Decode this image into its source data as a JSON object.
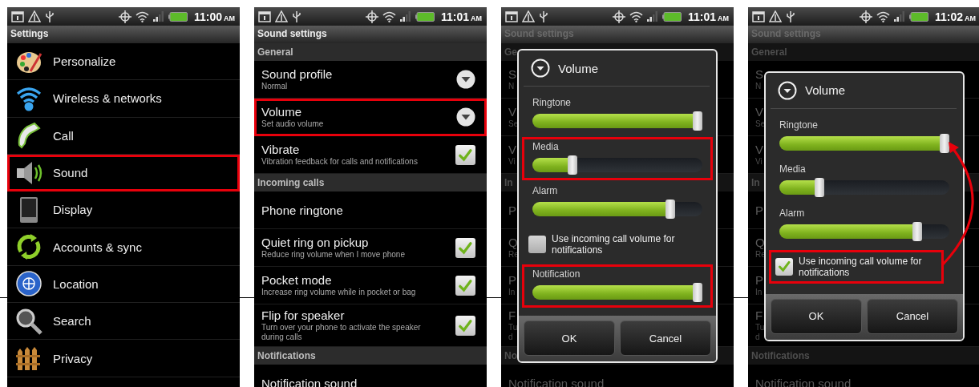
{
  "panels": [
    {
      "status_bar": {
        "time": "11:00",
        "meridiem": "AM"
      },
      "title": "Settings",
      "annotation_arrow": false,
      "items": [
        {
          "kind": "icon_entry",
          "label": "Personalize",
          "highlighted": false
        },
        {
          "kind": "icon_entry",
          "label": "Wireless & networks",
          "highlighted": false
        },
        {
          "kind": "icon_entry",
          "label": "Call",
          "highlighted": false
        },
        {
          "kind": "icon_entry",
          "label": "Sound",
          "highlighted": true
        },
        {
          "kind": "icon_entry",
          "label": "Display",
          "highlighted": false
        },
        {
          "kind": "icon_entry",
          "label": "Accounts & sync",
          "highlighted": false
        },
        {
          "kind": "icon_entry",
          "label": "Location",
          "highlighted": false
        },
        {
          "kind": "icon_entry",
          "label": "Search",
          "highlighted": false
        },
        {
          "kind": "icon_entry",
          "label": "Privacy",
          "highlighted": false
        }
      ]
    },
    {
      "status_bar": {
        "time": "11:01",
        "meridiem": "AM"
      },
      "title": "Sound settings",
      "annotation_arrow": false,
      "items": [
        {
          "kind": "header",
          "label": "General"
        },
        {
          "kind": "dropdown_setting",
          "title": "Sound profile",
          "subtitle": "Normal",
          "highlighted": false
        },
        {
          "kind": "dropdown_setting",
          "title": "Volume",
          "subtitle": "Set audio volume",
          "highlighted": true
        },
        {
          "kind": "checkbox_setting",
          "title": "Vibrate",
          "subtitle": "Vibration feedback for calls and notifications",
          "checked": true,
          "highlighted": false
        },
        {
          "kind": "header",
          "label": "Incoming calls"
        },
        {
          "kind": "setting",
          "title": "Phone ringtone",
          "highlighted": false
        },
        {
          "kind": "checkbox_setting",
          "title": "Quiet ring on pickup",
          "subtitle": "Reduce ring volume when I move phone",
          "checked": true,
          "highlighted": false
        },
        {
          "kind": "checkbox_setting",
          "title": "Pocket mode",
          "subtitle": "Increase ring volume while in pocket or bag",
          "checked": true,
          "highlighted": false
        },
        {
          "kind": "checkbox_setting",
          "title": "Flip for speaker",
          "subtitle": "Turn over your phone to activate the speaker during calls",
          "checked": true,
          "highlighted": false
        },
        {
          "kind": "header",
          "label": "Notifications"
        },
        {
          "kind": "setting",
          "title": "Notification sound",
          "highlighted": false
        }
      ]
    },
    {
      "status_bar": {
        "time": "11:01",
        "meridiem": "AM"
      },
      "title": "Sound settings",
      "annotation_arrow": false,
      "items": [
        {
          "kind": "header",
          "label": "Ge"
        },
        {
          "kind": "setting",
          "title": "S",
          "subtitle": "N",
          "highlighted": false
        },
        {
          "kind": "setting",
          "title": "V",
          "subtitle": "Se",
          "highlighted": false
        },
        {
          "kind": "setting",
          "title": "V",
          "subtitle": "Vi",
          "highlighted": false
        },
        {
          "kind": "header",
          "label": "In"
        },
        {
          "kind": "setting",
          "title": "P",
          "highlighted": false
        },
        {
          "kind": "setting",
          "title": "Q",
          "subtitle": "Re",
          "highlighted": false
        },
        {
          "kind": "setting",
          "title": "P",
          "subtitle": "In",
          "highlighted": false
        },
        {
          "kind": "setting",
          "title": "F",
          "subtitle": "Tu d",
          "highlighted": false
        },
        {
          "kind": "header",
          "label": "No"
        },
        {
          "kind": "setting",
          "title": "Notification sound",
          "highlighted": false
        }
      ],
      "dialog": {
        "title": "Volume",
        "controls": [
          {
            "kind": "slider",
            "label": "Ringtone",
            "level": 1,
            "highlighted": false
          },
          {
            "kind": "slider",
            "label": "Media",
            "level": 0.22,
            "highlighted": true
          },
          {
            "kind": "slider",
            "label": "Alarm",
            "level": 0.83,
            "highlighted": false
          },
          {
            "kind": "checkbox",
            "label": "Use incoming call volume for notifications",
            "checked": false,
            "highlighted": false
          },
          {
            "kind": "slider",
            "label": "Notification",
            "level": 1,
            "highlighted": true
          }
        ],
        "buttons": [
          "OK",
          "Cancel"
        ]
      }
    },
    {
      "status_bar": {
        "time": "11:02",
        "meridiem": "AM"
      },
      "title": "Sound settings",
      "annotation_arrow": true,
      "items": [
        {
          "kind": "header",
          "label": "General"
        },
        {
          "kind": "setting",
          "title": "S",
          "subtitle": "N",
          "highlighted": false
        },
        {
          "kind": "setting",
          "title": "V",
          "subtitle": "Se",
          "highlighted": false
        },
        {
          "kind": "setting",
          "title": "V",
          "subtitle": "Vi",
          "highlighted": false
        },
        {
          "kind": "header",
          "label": "In"
        },
        {
          "kind": "setting",
          "title": "P",
          "highlighted": false
        },
        {
          "kind": "setting",
          "title": "Q",
          "subtitle": "Re",
          "highlighted": false
        },
        {
          "kind": "setting",
          "title": "P",
          "subtitle": "In",
          "highlighted": false
        },
        {
          "kind": "setting",
          "title": "F",
          "subtitle": "Tu d",
          "highlighted": false
        },
        {
          "kind": "header",
          "label": "Notifications"
        },
        {
          "kind": "setting",
          "title": "Notification sound",
          "highlighted": false
        }
      ],
      "dialog": {
        "title": "Volume",
        "controls": [
          {
            "kind": "slider",
            "label": "Ringtone",
            "level": 1,
            "highlighted": false
          },
          {
            "kind": "slider",
            "label": "Media",
            "level": 0.22,
            "highlighted": false
          },
          {
            "kind": "slider",
            "label": "Alarm",
            "level": 0.83,
            "highlighted": false
          },
          {
            "kind": "checkbox",
            "label": "Use incoming call volume for notifications",
            "checked": true,
            "highlighted": true
          }
        ],
        "buttons": [
          "OK",
          "Cancel"
        ]
      }
    }
  ]
}
